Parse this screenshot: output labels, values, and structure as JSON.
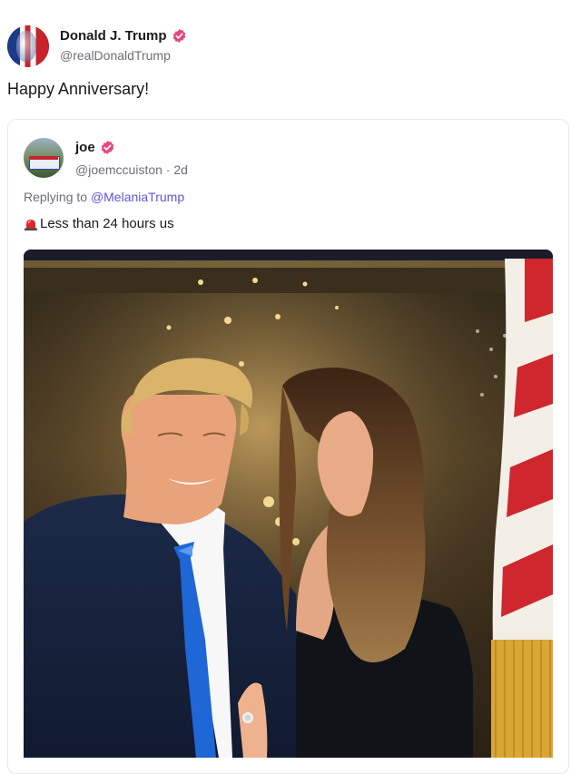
{
  "post": {
    "author_name": "Donald J. Trump",
    "author_handle": "@realDonaldTrump",
    "text": "Happy Anniversary!"
  },
  "quoted": {
    "author_name": "joe",
    "author_handle_time": "@joemccuiston · 2d",
    "replying_prefix": "Replying to ",
    "replying_to": "@MelaniaTrump",
    "text": "Less than 24 hours us",
    "emoji": "siren-icon"
  },
  "colors": {
    "verified": "#e8467c",
    "mention": "#5b57d6",
    "muted": "#6b6f76"
  }
}
